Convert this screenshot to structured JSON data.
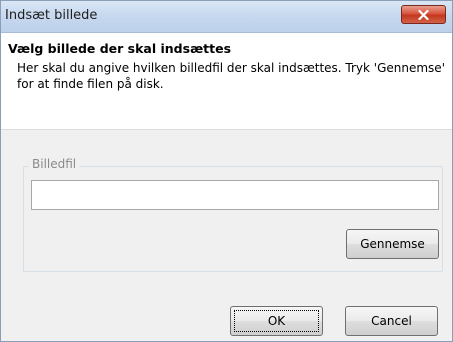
{
  "window": {
    "title": "Indsæt billede",
    "close_icon": "close-x-icon"
  },
  "header": {
    "title": "Vælg billede der skal indsættes",
    "description": "Her skal du angive hvilken billedfil der skal indsættes. Tryk 'Gennemse' for at finde filen på disk."
  },
  "file_group": {
    "label": "Billedfil",
    "input_value": "",
    "browse_label": "Gennemse"
  },
  "footer": {
    "ok_label": "OK",
    "cancel_label": "Cancel"
  },
  "colors": {
    "close_button": "#d8543c",
    "titlebar": "#c5d7ee",
    "dialog_background": "#f0f0f0"
  }
}
